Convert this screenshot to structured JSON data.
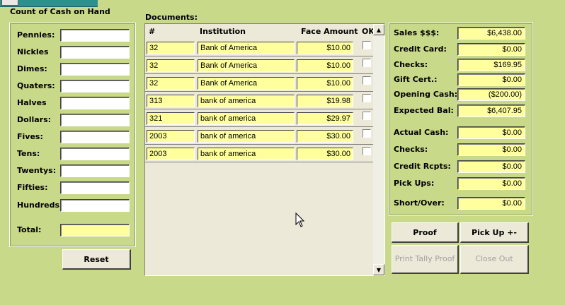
{
  "cash_panel": {
    "title": "Count of Cash on Hand",
    "fields": [
      {
        "label": "Pennies:",
        "value": ""
      },
      {
        "label": "Nickles",
        "value": ""
      },
      {
        "label": "Dimes:",
        "value": ""
      },
      {
        "label": "Quaters:",
        "value": ""
      },
      {
        "label": "Halves",
        "value": ""
      },
      {
        "label": "Dollars:",
        "value": ""
      },
      {
        "label": "Fives:",
        "value": ""
      },
      {
        "label": "Tens:",
        "value": ""
      },
      {
        "label": "Twentys:",
        "value": ""
      },
      {
        "label": "Fifties:",
        "value": ""
      },
      {
        "label": "Hundreds:",
        "value": ""
      }
    ],
    "total_label": "Total:",
    "total_value": "",
    "reset_label": "Reset"
  },
  "documents": {
    "title": "Documents:",
    "headers": {
      "num": "#",
      "institution": "Institution",
      "amount": "Face Amount",
      "ok": "OK"
    },
    "rows": [
      {
        "num": "32",
        "institution": "Bank of America",
        "amount": "$10.00",
        "ok": false
      },
      {
        "num": "32",
        "institution": "Bank of America",
        "amount": "$10.00",
        "ok": false
      },
      {
        "num": "32",
        "institution": "Bank of America",
        "amount": "$10.00",
        "ok": false
      },
      {
        "num": "313",
        "institution": "bank of america",
        "amount": "$19.98",
        "ok": false
      },
      {
        "num": "321",
        "institution": "bank of america",
        "amount": "$29.97",
        "ok": false
      },
      {
        "num": "2003",
        "institution": "bank of america",
        "amount": "$30.00",
        "ok": false
      },
      {
        "num": "2003",
        "institution": "bank of america",
        "amount": "$30.00",
        "ok": false
      }
    ]
  },
  "summary": {
    "top": [
      {
        "label": "Sales $$$:",
        "value": "$6,438.00"
      },
      {
        "label": "Credit Card:",
        "value": "$0.00"
      },
      {
        "label": "Checks:",
        "value": "$169.95"
      },
      {
        "label": "Gift Cert.:",
        "value": "$0.00"
      },
      {
        "label": "Opening Cash:",
        "value": "($200.00)"
      },
      {
        "label": "Expected Bal:",
        "value": "$6,407.95"
      }
    ],
    "bottom": [
      {
        "label": "Actual Cash:",
        "value": "$0.00"
      },
      {
        "label": "Checks:",
        "value": "$0.00"
      },
      {
        "label": "Credit Rcpts:",
        "value": "$0.00"
      },
      {
        "label": "Pick Ups:",
        "value": "$0.00"
      },
      {
        "label": "Short/Over:",
        "value": "$0.00"
      }
    ]
  },
  "buttons": {
    "proof": "Proof",
    "pickup": "Pick Up +-",
    "print_tally": "Print Tally Proof",
    "close_out": "Close Out"
  },
  "icons": {
    "scroll_up": "▲",
    "scroll_down": "▼"
  },
  "colors": {
    "background": "#c9d98a",
    "field_yellow": "#ffff9e"
  }
}
